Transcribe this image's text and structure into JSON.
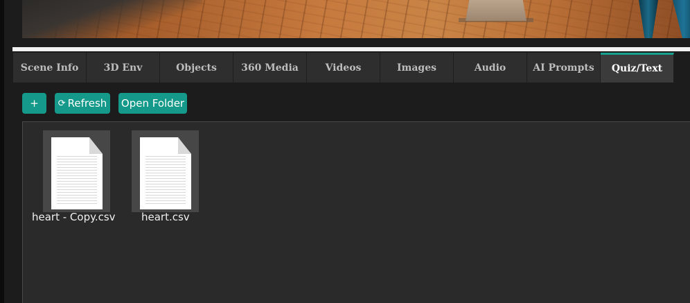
{
  "tabs": [
    {
      "label": "Scene Info",
      "active": false
    },
    {
      "label": "3D Env",
      "active": false
    },
    {
      "label": "Objects",
      "active": false
    },
    {
      "label": "360 Media",
      "active": false
    },
    {
      "label": "Videos",
      "active": false
    },
    {
      "label": "Images",
      "active": false
    },
    {
      "label": "Audio",
      "active": false
    },
    {
      "label": "AI Prompts",
      "active": false
    },
    {
      "label": "Quiz/Text",
      "active": true
    }
  ],
  "toolbar": {
    "add_label": "+",
    "refresh_icon": "⟳",
    "refresh_label": "Refresh",
    "open_folder_label": "Open Folder"
  },
  "files": [
    {
      "name": "heart - Copy.csv",
      "icon": "document-icon"
    },
    {
      "name": "heart.csv",
      "icon": "document-icon"
    }
  ],
  "colors": {
    "accent": "#15998a",
    "active_tab_bg": "#3b3b3b",
    "tab_bg": "#2e2e2e",
    "panel_bg": "#2a2a2a",
    "page_bg": "#1c1c1c"
  }
}
